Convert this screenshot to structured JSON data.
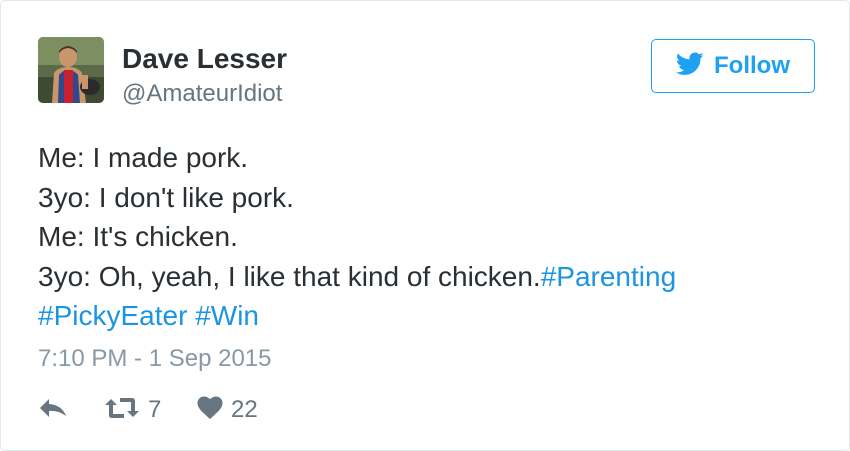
{
  "user": {
    "display_name": "Dave Lesser",
    "handle": "@AmateurIdiot"
  },
  "follow_button": {
    "label": "Follow",
    "icon": "twitter-bird-icon"
  },
  "tweet": {
    "lines": [
      {
        "text": "Me: I made pork."
      },
      {
        "text": "3yo: I don't like pork."
      },
      {
        "text": "Me: It's chicken."
      },
      {
        "text": "3yo: Oh, yeah, I like that kind of chicken.",
        "hashtag": "#Parenting"
      }
    ],
    "hashtags_line2": [
      "#PickyEater",
      "#Win"
    ],
    "timestamp": "7:10 PM - 1 Sep 2015"
  },
  "actions": {
    "reply": {
      "icon": "reply-icon"
    },
    "retweet": {
      "icon": "retweet-icon",
      "count": "7"
    },
    "like": {
      "icon": "heart-icon",
      "count": "22"
    }
  },
  "colors": {
    "brand": "#1da1f2",
    "hashtag": "#1b95e0",
    "text": "#292f33",
    "muted": "#66757f"
  }
}
